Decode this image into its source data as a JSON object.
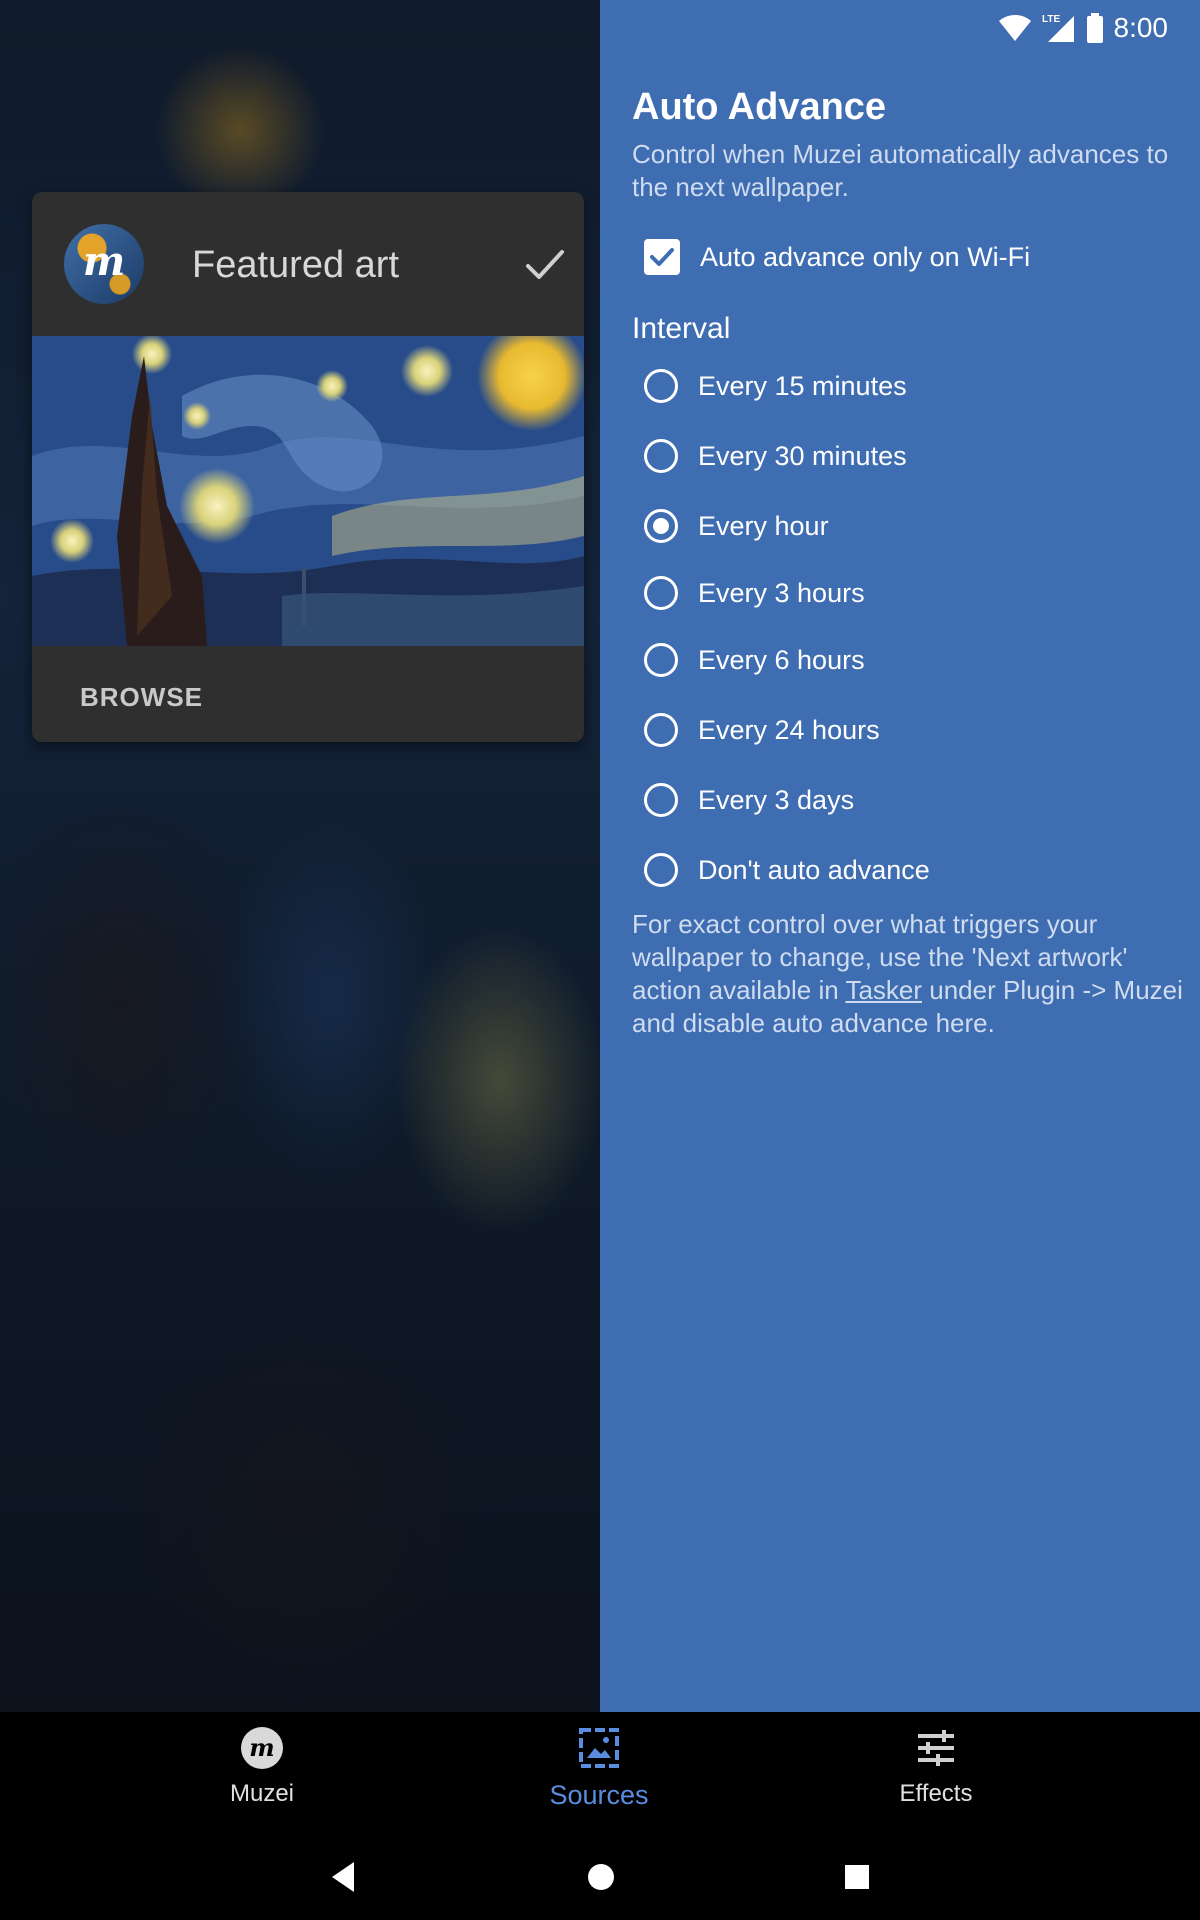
{
  "status_bar": {
    "time": "8:00",
    "network": "LTE"
  },
  "source_card": {
    "title": "Featured art",
    "avatar_letter": "m",
    "browse_label": "BROWSE"
  },
  "auto_advance": {
    "title": "Auto Advance",
    "subtitle": "Control when Muzei automatically advances to the next wallpaper.",
    "wifi_only_label": "Auto advance only on Wi-Fi",
    "wifi_only_checked": true,
    "interval_heading": "Interval",
    "options": [
      {
        "label": "Every 15 minutes",
        "selected": false
      },
      {
        "label": "Every 30 minutes",
        "selected": false
      },
      {
        "label": "Every hour",
        "selected": true
      },
      {
        "label": "Every 3 hours",
        "selected": false
      },
      {
        "label": "Every 6 hours",
        "selected": false
      },
      {
        "label": "Every 24 hours",
        "selected": false
      },
      {
        "label": "Every 3 days",
        "selected": false
      },
      {
        "label": "Don't auto advance",
        "selected": false
      }
    ],
    "footnote_part1": "For exact control over what triggers your wallpaper to change, use the 'Next artwork' action available in ",
    "footnote_link": "Tasker",
    "footnote_part2": " under Plugin -> Muzei and disable auto advance here."
  },
  "bottom_nav": {
    "muzei_label": "Muzei",
    "sources_label": "Sources",
    "effects_label": "Effects",
    "active": "Sources",
    "active_color": "#5a8de0"
  },
  "colors": {
    "panel": "#3f6db2",
    "card": "#2f2f2f"
  }
}
